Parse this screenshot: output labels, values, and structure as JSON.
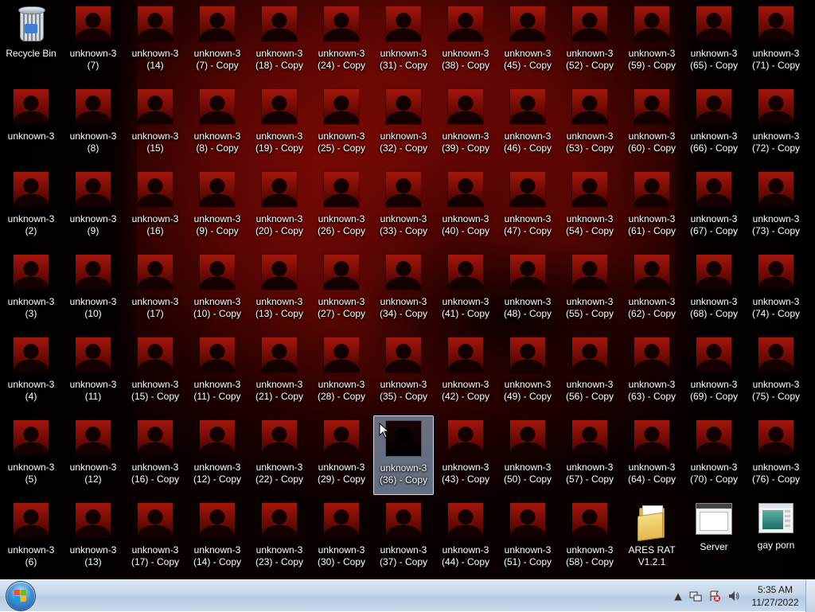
{
  "desktop": {
    "icons": [
      {
        "label": "Recycle Bin",
        "kind": "recycle-bin"
      },
      {
        "label": "unknown-3\n(7)"
      },
      {
        "label": "unknown-3\n(14)"
      },
      {
        "label": "unknown-3\n(7) - Copy"
      },
      {
        "label": "unknown-3\n(18) - Copy"
      },
      {
        "label": "unknown-3\n(24) - Copy"
      },
      {
        "label": "unknown-3\n(31) - Copy"
      },
      {
        "label": "unknown-3\n(38) - Copy"
      },
      {
        "label": "unknown-3\n(45) - Copy"
      },
      {
        "label": "unknown-3\n(52) - Copy"
      },
      {
        "label": "unknown-3\n(59) - Copy"
      },
      {
        "label": "unknown-3\n(65) - Copy"
      },
      {
        "label": "unknown-3\n(71) - Copy"
      },
      {
        "label": "unknown-3"
      },
      {
        "label": "unknown-3\n(8)"
      },
      {
        "label": "unknown-3\n(15)"
      },
      {
        "label": "unknown-3\n(8) - Copy"
      },
      {
        "label": "unknown-3\n(19) - Copy"
      },
      {
        "label": "unknown-3\n(25) - Copy"
      },
      {
        "label": "unknown-3\n(32) - Copy"
      },
      {
        "label": "unknown-3\n(39) - Copy"
      },
      {
        "label": "unknown-3\n(46) - Copy"
      },
      {
        "label": "unknown-3\n(53) - Copy"
      },
      {
        "label": "unknown-3\n(60) - Copy"
      },
      {
        "label": "unknown-3\n(66) - Copy"
      },
      {
        "label": "unknown-3\n(72) - Copy"
      },
      {
        "label": "unknown-3\n(2)"
      },
      {
        "label": "unknown-3\n(9)"
      },
      {
        "label": "unknown-3\n(16)"
      },
      {
        "label": "unknown-3\n(9) - Copy"
      },
      {
        "label": "unknown-3\n(20) - Copy"
      },
      {
        "label": "unknown-3\n(26) - Copy"
      },
      {
        "label": "unknown-3\n(33) - Copy"
      },
      {
        "label": "unknown-3\n(40) - Copy"
      },
      {
        "label": "unknown-3\n(47) - Copy"
      },
      {
        "label": "unknown-3\n(54) - Copy"
      },
      {
        "label": "unknown-3\n(61) - Copy"
      },
      {
        "label": "unknown-3\n(67) - Copy"
      },
      {
        "label": "unknown-3\n(73) - Copy"
      },
      {
        "label": "unknown-3\n(3)"
      },
      {
        "label": "unknown-3\n(10)"
      },
      {
        "label": "unknown-3\n(17)"
      },
      {
        "label": "unknown-3\n(10) - Copy"
      },
      {
        "label": "unknown-3\n(13) - Copy"
      },
      {
        "label": "unknown-3\n(27) - Copy"
      },
      {
        "label": "unknown-3\n(34) - Copy"
      },
      {
        "label": "unknown-3\n(41) - Copy"
      },
      {
        "label": "unknown-3\n(48) - Copy"
      },
      {
        "label": "unknown-3\n(55) - Copy"
      },
      {
        "label": "unknown-3\n(62) - Copy"
      },
      {
        "label": "unknown-3\n(68) - Copy"
      },
      {
        "label": "unknown-3\n(74) - Copy"
      },
      {
        "label": "unknown-3\n(4)"
      },
      {
        "label": "unknown-3\n(11)"
      },
      {
        "label": "unknown-3\n(15) - Copy"
      },
      {
        "label": "unknown-3\n(11) - Copy"
      },
      {
        "label": "unknown-3\n(21) - Copy"
      },
      {
        "label": "unknown-3\n(28) - Copy"
      },
      {
        "label": "unknown-3\n(35) - Copy"
      },
      {
        "label": "unknown-3\n(42) - Copy"
      },
      {
        "label": "unknown-3\n(49) - Copy"
      },
      {
        "label": "unknown-3\n(56) - Copy"
      },
      {
        "label": "unknown-3\n(63) - Copy"
      },
      {
        "label": "unknown-3\n(69) - Copy"
      },
      {
        "label": "unknown-3\n(75) - Copy"
      },
      {
        "label": "unknown-3\n(5)"
      },
      {
        "label": "unknown-3\n(12)"
      },
      {
        "label": "unknown-3\n(16) - Copy"
      },
      {
        "label": "unknown-3\n(12) - Copy"
      },
      {
        "label": "unknown-3\n(22) - Copy"
      },
      {
        "label": "unknown-3\n(29) - Copy"
      },
      {
        "label": "unknown-3\n(36) - Copy",
        "selected": true
      },
      {
        "label": "unknown-3\n(43) - Copy"
      },
      {
        "label": "unknown-3\n(50) - Copy"
      },
      {
        "label": "unknown-3\n(57) - Copy"
      },
      {
        "label": "unknown-3\n(64) - Copy"
      },
      {
        "label": "unknown-3\n(70) - Copy"
      },
      {
        "label": "unknown-3\n(76) - Copy"
      },
      {
        "label": "unknown-3\n(6)"
      },
      {
        "label": "unknown-3\n(13)"
      },
      {
        "label": "unknown-3\n(17) - Copy"
      },
      {
        "label": "unknown-3\n(14) - Copy"
      },
      {
        "label": "unknown-3\n(23) - Copy"
      },
      {
        "label": "unknown-3\n(30) - Copy"
      },
      {
        "label": "unknown-3\n(37) - Copy"
      },
      {
        "label": "unknown-3\n(44) - Copy"
      },
      {
        "label": "unknown-3\n(51) - Copy"
      },
      {
        "label": "unknown-3\n(58) - Copy"
      },
      {
        "label": "ARES RAT\nV1.2.1",
        "kind": "folder"
      },
      {
        "label": "Server",
        "kind": "window"
      },
      {
        "label": "gay porn",
        "kind": "picture"
      }
    ]
  },
  "taskbar": {
    "start_label": "Start",
    "clock": {
      "time": "5:35 AM",
      "date": "11/27/2022"
    },
    "tray_icons": [
      "show-hidden-icon",
      "network-icon",
      "action-center-icon",
      "volume-icon"
    ]
  }
}
